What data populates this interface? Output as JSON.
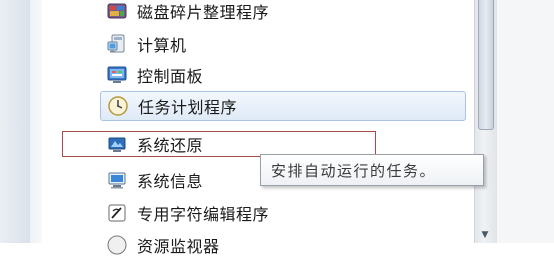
{
  "menu": {
    "items": [
      {
        "label": "磁盘碎片整理程序",
        "icon": "defrag-icon"
      },
      {
        "label": "计算机",
        "icon": "computer-icon"
      },
      {
        "label": "控制面板",
        "icon": "control-panel-icon"
      },
      {
        "label": "任务计划程序",
        "icon": "task-scheduler-icon"
      },
      {
        "label": "系统还原",
        "icon": "system-restore-icon"
      },
      {
        "label": "系统信息",
        "icon": "system-info-icon"
      },
      {
        "label": "专用字符编辑程序",
        "icon": "char-editor-icon"
      },
      {
        "label": "资源监视器",
        "icon": "resource-monitor-icon"
      }
    ],
    "highlighted_index": 3,
    "annotated_index": 4
  },
  "tooltip": {
    "text": "安排自动运行的任务。"
  },
  "colors": {
    "highlight_border": "#a8c3e3",
    "annotation_box": "#a64a4a"
  }
}
